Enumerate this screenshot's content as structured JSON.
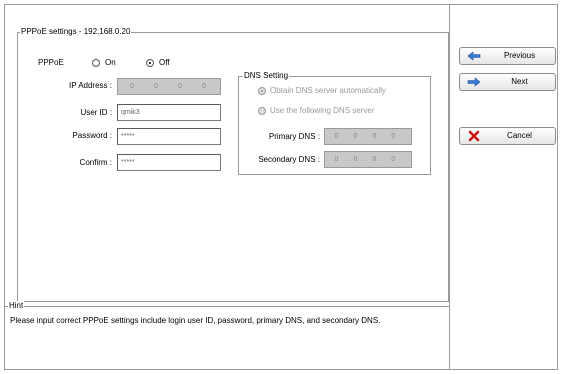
{
  "settings": {
    "title": "PPPoE settings - 192.168.0.20",
    "pppoe_label": "PPPoE",
    "on_label": "On",
    "off_label": "Off",
    "pppoe_selected": "Off"
  },
  "fields": {
    "ip_label": "IP Address :",
    "ip_value": [
      "0",
      "0",
      "0",
      "0"
    ],
    "userid_label": "User ID :",
    "userid_value": "qmik3",
    "password_label": "Password :",
    "password_value": "*****",
    "confirm_label": "Confirm :",
    "confirm_value": "*****"
  },
  "dns": {
    "title": "DNS Setting",
    "obtain_label": "Obtain DNS server automatically",
    "manual_label": "Use the following DNS server",
    "selected": "obtain",
    "primary_label": "Primary DNS :",
    "primary_value": [
      "0",
      "0",
      "0",
      "0"
    ],
    "secondary_label": "Secondary DNS :",
    "secondary_value": [
      "0",
      "0",
      "0",
      "0"
    ]
  },
  "hint": {
    "title": "Hint",
    "text": "Please input correct PPPoE settings include login user ID, password, primary DNS, and secondary DNS."
  },
  "buttons": {
    "previous": "Previous",
    "next": "Next",
    "cancel": "Cancel"
  },
  "icons": {
    "previous": "arrow-left-icon",
    "next": "arrow-right-icon",
    "cancel": "cross-icon"
  },
  "colors": {
    "arrow": "#3a7bd5",
    "cancel": "#cc1111"
  }
}
